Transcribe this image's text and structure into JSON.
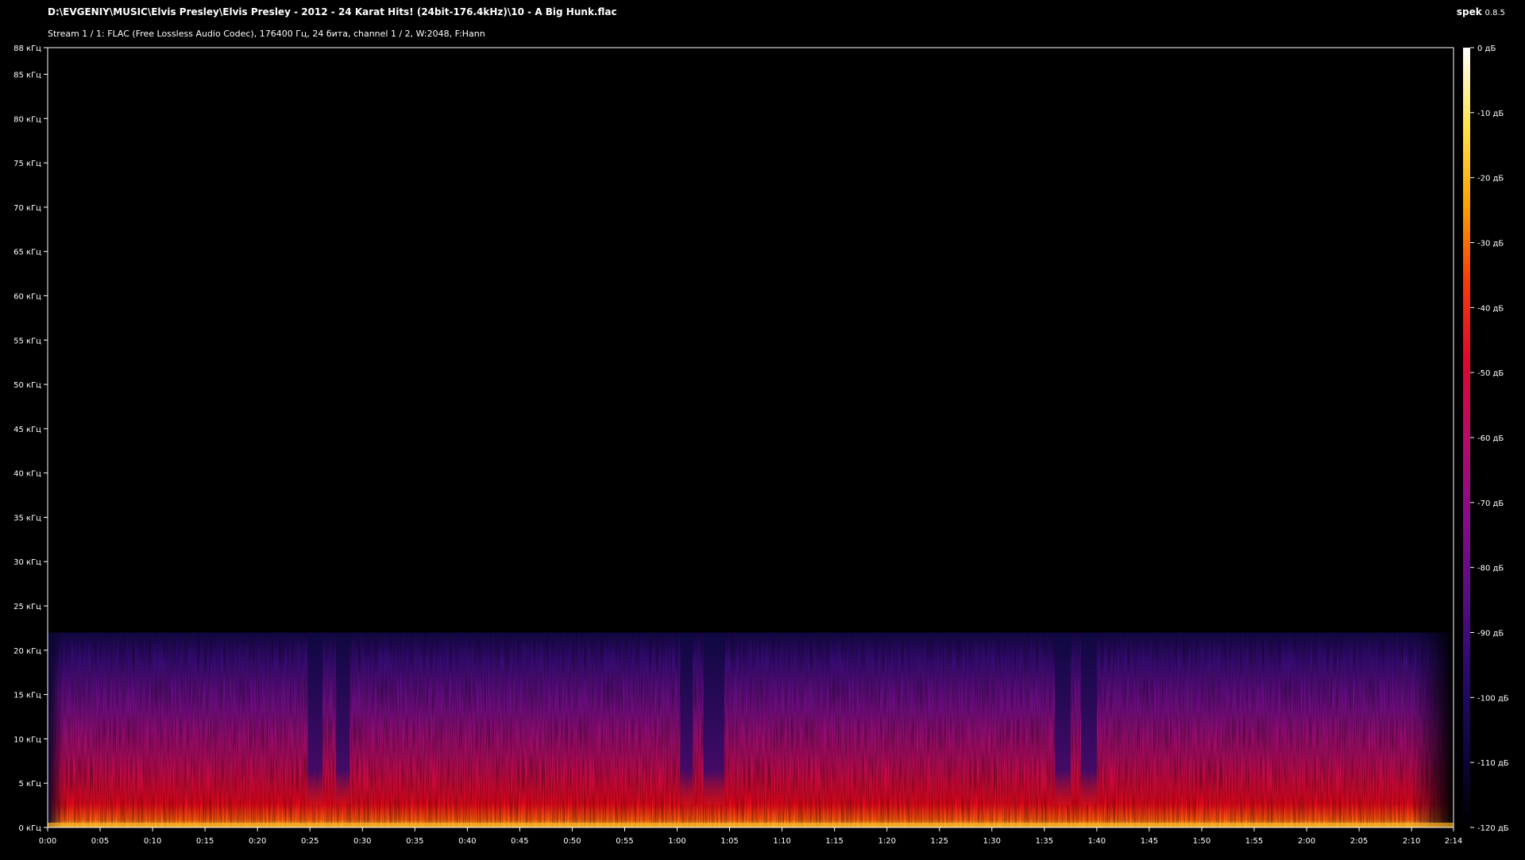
{
  "header": {
    "file_path": "D:\\EVGENIY\\MUSIC\\Elvis Presley\\Elvis Presley - 2012 - 24 Karat Hits! (24bit-176.4kHz)\\10 - A Big Hunk.flac",
    "stream_info": "Stream 1 / 1: FLAC (Free Lossless Audio Codec), 176400 Гц, 24 бита, channel 1 / 2, W:2048, F:Hann",
    "app_name": "spek",
    "app_version": "0.8.5"
  },
  "chart_data": {
    "type": "heatmap",
    "y_axis": {
      "unit": "кГц",
      "range": [
        0,
        88
      ],
      "ticks": [
        "0 кГц",
        "5 кГц",
        "10 кГц",
        "15 кГц",
        "20 кГц",
        "25 кГц",
        "30 кГц",
        "35 кГц",
        "40 кГц",
        "45 кГц",
        "50 кГц",
        "55 кГц",
        "60 кГц",
        "65 кГц",
        "70 кГц",
        "75 кГц",
        "80 кГц",
        "85 кГц",
        "88 кГц"
      ],
      "tick_values": [
        0,
        5,
        10,
        15,
        20,
        25,
        30,
        35,
        40,
        45,
        50,
        55,
        60,
        65,
        70,
        75,
        80,
        85,
        88
      ]
    },
    "x_axis": {
      "range_seconds": [
        0,
        134
      ],
      "ticks": [
        "0:00",
        "0:05",
        "0:10",
        "0:15",
        "0:20",
        "0:25",
        "0:30",
        "0:35",
        "0:40",
        "0:45",
        "0:50",
        "0:55",
        "1:00",
        "1:05",
        "1:10",
        "1:15",
        "1:20",
        "1:25",
        "1:30",
        "1:35",
        "1:40",
        "1:45",
        "1:50",
        "1:55",
        "2:00",
        "2:05",
        "2:10",
        "2:14"
      ],
      "tick_values": [
        0,
        5,
        10,
        15,
        20,
        25,
        30,
        35,
        40,
        45,
        50,
        55,
        60,
        65,
        70,
        75,
        80,
        85,
        90,
        95,
        100,
        105,
        110,
        115,
        120,
        125,
        130,
        134
      ]
    },
    "colorbar": {
      "unit": "дБ",
      "range": [
        -120,
        0
      ],
      "ticks": [
        "0 дБ",
        "-10 дБ",
        "-20 дБ",
        "-30 дБ",
        "-40 дБ",
        "-50 дБ",
        "-60 дБ",
        "-70 дБ",
        "-80 дБ",
        "-90 дБ",
        "-100 дБ",
        "-110 дБ",
        "-120 дБ"
      ],
      "tick_values": [
        0,
        -10,
        -20,
        -30,
        -40,
        -50,
        -60,
        -70,
        -80,
        -90,
        -100,
        -110,
        -120
      ],
      "colors": [
        "#000000",
        "#0d0640",
        "#2a0a6e",
        "#5a0c86",
        "#8a0a8a",
        "#b80a6a",
        "#e0062e",
        "#f83a08",
        "#ffa200",
        "#ffe24a",
        "#ffffff"
      ]
    },
    "content_cutoff_khz": 22,
    "quiet_passages_seconds": [
      [
        24.8,
        26.2
      ],
      [
        27.5,
        28.8
      ],
      [
        60.3,
        61.5
      ],
      [
        62.5,
        64.5
      ],
      [
        96,
        97.5
      ],
      [
        98.5,
        100
      ]
    ],
    "fade_in_seconds": [
      0,
      1.5
    ],
    "fade_out_seconds": [
      130,
      134
    ]
  }
}
